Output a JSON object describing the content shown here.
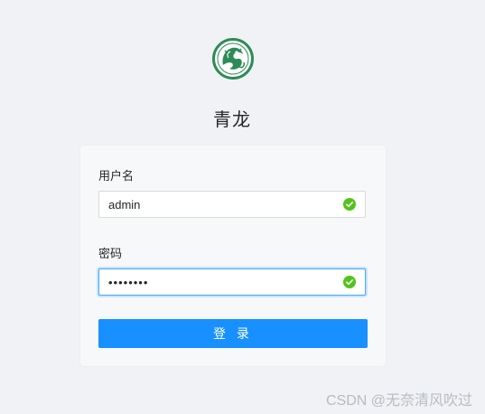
{
  "app": {
    "title": "青龙"
  },
  "login_form": {
    "username": {
      "label": "用户名",
      "value": "admin"
    },
    "password": {
      "label": "密码",
      "value": "admin123"
    },
    "submit_label": "登 录"
  },
  "watermark": "CSDN @无奈清风吹过",
  "colors": {
    "primary": "#1890ff",
    "success": "#52c41a",
    "logo_green": "#2e8b57",
    "background": "#f0f2f5"
  },
  "icons": {
    "logo": "qinglong-dragon-logo",
    "validation": "check-circle-icon"
  }
}
